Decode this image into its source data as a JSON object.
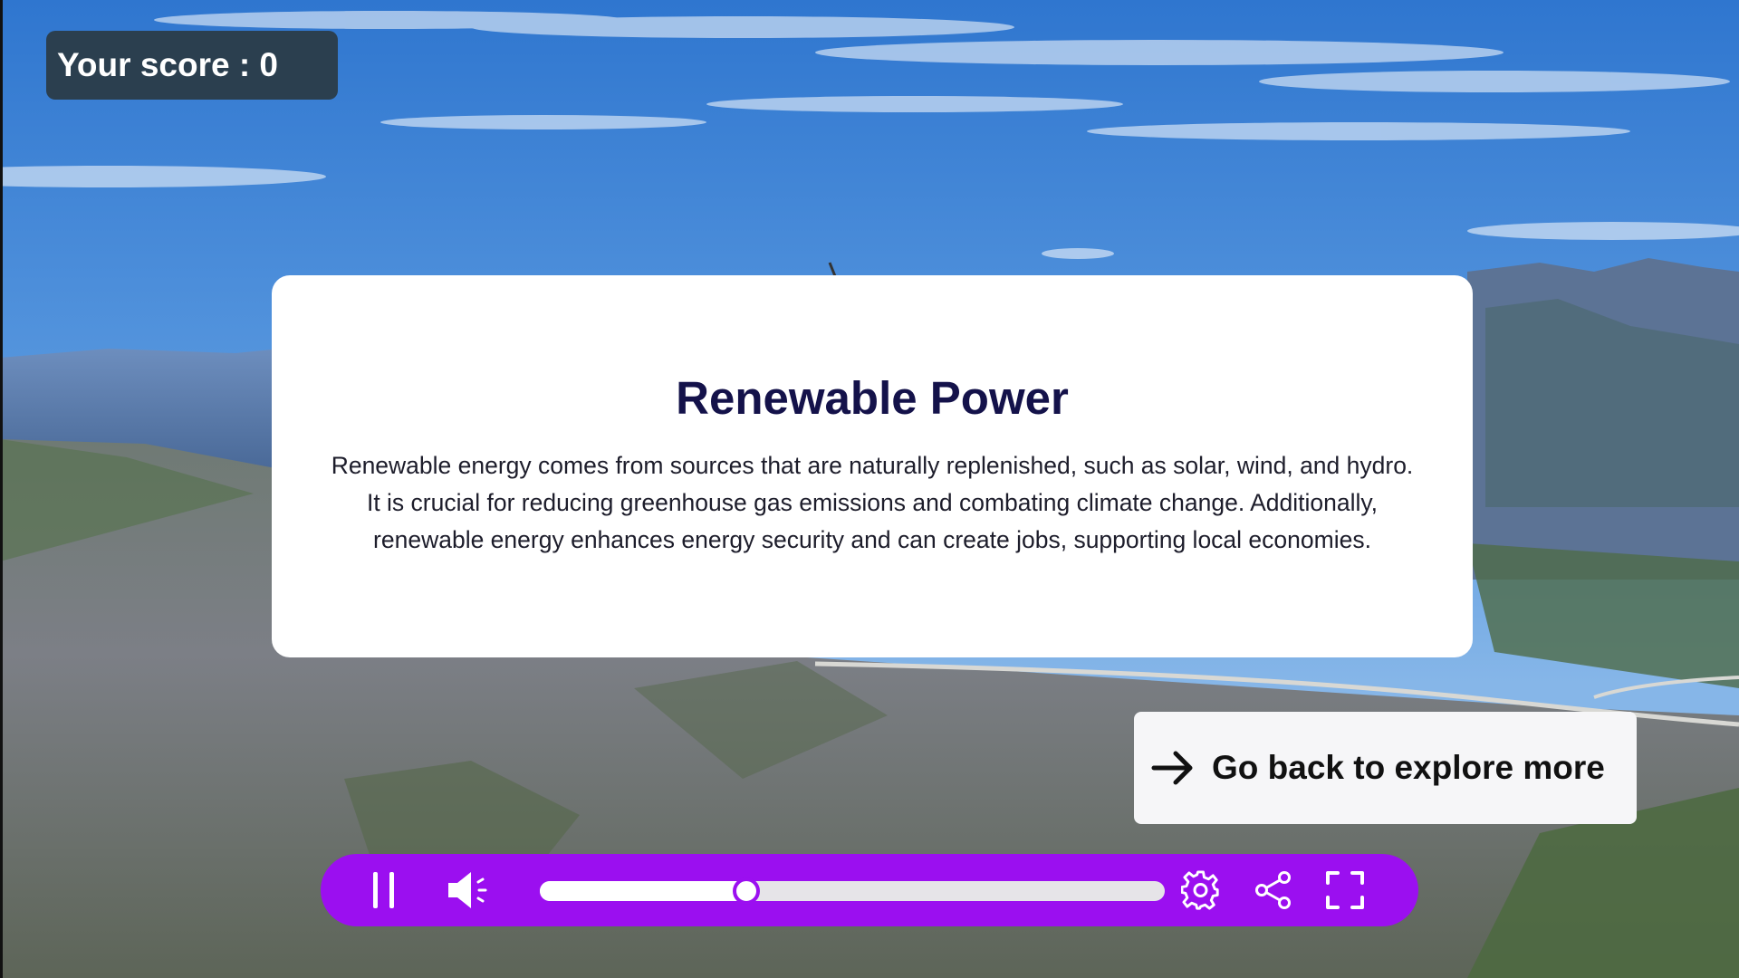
{
  "score": {
    "label": "Your score : 0",
    "value": 0
  },
  "card": {
    "title": "Renewable Power",
    "lines": [
      "Renewable energy comes from sources that are naturally replenished, such as solar, wind, and hydro.",
      "It is crucial for reducing greenhouse gas emissions and combating climate change. Additionally,",
      "renewable energy enhances energy security and can create jobs, supporting local economies."
    ]
  },
  "navigation": {
    "go_back_label": "Go back to explore more",
    "go_back_icon": "arrow-right-icon"
  },
  "player": {
    "state": "playing",
    "progress": 0.33,
    "controls": [
      {
        "name": "pause",
        "icon": "pause-icon"
      },
      {
        "name": "volume",
        "icon": "volume-icon"
      },
      {
        "name": "settings",
        "icon": "gear-icon"
      },
      {
        "name": "share",
        "icon": "share-icon"
      },
      {
        "name": "fullscreen",
        "icon": "fullscreen-icon"
      }
    ]
  },
  "colors": {
    "player_bar": "#9b0ff0",
    "score_badge": "#2b3f4f",
    "card_title": "#14124a",
    "sky": "#3f86d6"
  }
}
